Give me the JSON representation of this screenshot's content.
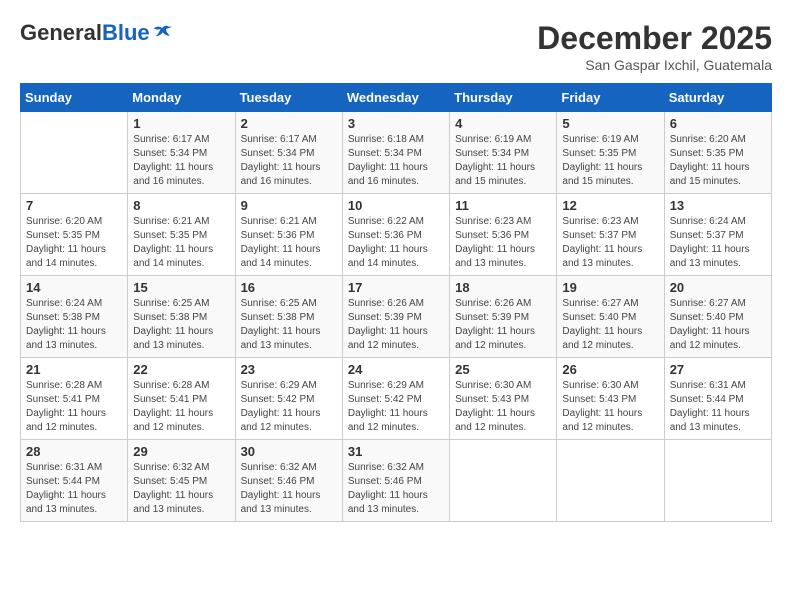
{
  "header": {
    "logo": {
      "general": "General",
      "blue": "Blue"
    },
    "month_title": "December 2025",
    "subtitle": "San Gaspar Ixchil, Guatemala"
  },
  "calendar": {
    "days_of_week": [
      "Sunday",
      "Monday",
      "Tuesday",
      "Wednesday",
      "Thursday",
      "Friday",
      "Saturday"
    ],
    "weeks": [
      [
        {
          "day": "",
          "info": ""
        },
        {
          "day": "1",
          "info": "Sunrise: 6:17 AM\nSunset: 5:34 PM\nDaylight: 11 hours and 16 minutes."
        },
        {
          "day": "2",
          "info": "Sunrise: 6:17 AM\nSunset: 5:34 PM\nDaylight: 11 hours and 16 minutes."
        },
        {
          "day": "3",
          "info": "Sunrise: 6:18 AM\nSunset: 5:34 PM\nDaylight: 11 hours and 16 minutes."
        },
        {
          "day": "4",
          "info": "Sunrise: 6:19 AM\nSunset: 5:34 PM\nDaylight: 11 hours and 15 minutes."
        },
        {
          "day": "5",
          "info": "Sunrise: 6:19 AM\nSunset: 5:35 PM\nDaylight: 11 hours and 15 minutes."
        },
        {
          "day": "6",
          "info": "Sunrise: 6:20 AM\nSunset: 5:35 PM\nDaylight: 11 hours and 15 minutes."
        }
      ],
      [
        {
          "day": "7",
          "info": "Sunrise: 6:20 AM\nSunset: 5:35 PM\nDaylight: 11 hours and 14 minutes."
        },
        {
          "day": "8",
          "info": "Sunrise: 6:21 AM\nSunset: 5:35 PM\nDaylight: 11 hours and 14 minutes."
        },
        {
          "day": "9",
          "info": "Sunrise: 6:21 AM\nSunset: 5:36 PM\nDaylight: 11 hours and 14 minutes."
        },
        {
          "day": "10",
          "info": "Sunrise: 6:22 AM\nSunset: 5:36 PM\nDaylight: 11 hours and 14 minutes."
        },
        {
          "day": "11",
          "info": "Sunrise: 6:23 AM\nSunset: 5:36 PM\nDaylight: 11 hours and 13 minutes."
        },
        {
          "day": "12",
          "info": "Sunrise: 6:23 AM\nSunset: 5:37 PM\nDaylight: 11 hours and 13 minutes."
        },
        {
          "day": "13",
          "info": "Sunrise: 6:24 AM\nSunset: 5:37 PM\nDaylight: 11 hours and 13 minutes."
        }
      ],
      [
        {
          "day": "14",
          "info": "Sunrise: 6:24 AM\nSunset: 5:38 PM\nDaylight: 11 hours and 13 minutes."
        },
        {
          "day": "15",
          "info": "Sunrise: 6:25 AM\nSunset: 5:38 PM\nDaylight: 11 hours and 13 minutes."
        },
        {
          "day": "16",
          "info": "Sunrise: 6:25 AM\nSunset: 5:38 PM\nDaylight: 11 hours and 13 minutes."
        },
        {
          "day": "17",
          "info": "Sunrise: 6:26 AM\nSunset: 5:39 PM\nDaylight: 11 hours and 12 minutes."
        },
        {
          "day": "18",
          "info": "Sunrise: 6:26 AM\nSunset: 5:39 PM\nDaylight: 11 hours and 12 minutes."
        },
        {
          "day": "19",
          "info": "Sunrise: 6:27 AM\nSunset: 5:40 PM\nDaylight: 11 hours and 12 minutes."
        },
        {
          "day": "20",
          "info": "Sunrise: 6:27 AM\nSunset: 5:40 PM\nDaylight: 11 hours and 12 minutes."
        }
      ],
      [
        {
          "day": "21",
          "info": "Sunrise: 6:28 AM\nSunset: 5:41 PM\nDaylight: 11 hours and 12 minutes."
        },
        {
          "day": "22",
          "info": "Sunrise: 6:28 AM\nSunset: 5:41 PM\nDaylight: 11 hours and 12 minutes."
        },
        {
          "day": "23",
          "info": "Sunrise: 6:29 AM\nSunset: 5:42 PM\nDaylight: 11 hours and 12 minutes."
        },
        {
          "day": "24",
          "info": "Sunrise: 6:29 AM\nSunset: 5:42 PM\nDaylight: 11 hours and 12 minutes."
        },
        {
          "day": "25",
          "info": "Sunrise: 6:30 AM\nSunset: 5:43 PM\nDaylight: 11 hours and 12 minutes."
        },
        {
          "day": "26",
          "info": "Sunrise: 6:30 AM\nSunset: 5:43 PM\nDaylight: 11 hours and 12 minutes."
        },
        {
          "day": "27",
          "info": "Sunrise: 6:31 AM\nSunset: 5:44 PM\nDaylight: 11 hours and 13 minutes."
        }
      ],
      [
        {
          "day": "28",
          "info": "Sunrise: 6:31 AM\nSunset: 5:44 PM\nDaylight: 11 hours and 13 minutes."
        },
        {
          "day": "29",
          "info": "Sunrise: 6:32 AM\nSunset: 5:45 PM\nDaylight: 11 hours and 13 minutes."
        },
        {
          "day": "30",
          "info": "Sunrise: 6:32 AM\nSunset: 5:46 PM\nDaylight: 11 hours and 13 minutes."
        },
        {
          "day": "31",
          "info": "Sunrise: 6:32 AM\nSunset: 5:46 PM\nDaylight: 11 hours and 13 minutes."
        },
        {
          "day": "",
          "info": ""
        },
        {
          "day": "",
          "info": ""
        },
        {
          "day": "",
          "info": ""
        }
      ]
    ]
  }
}
